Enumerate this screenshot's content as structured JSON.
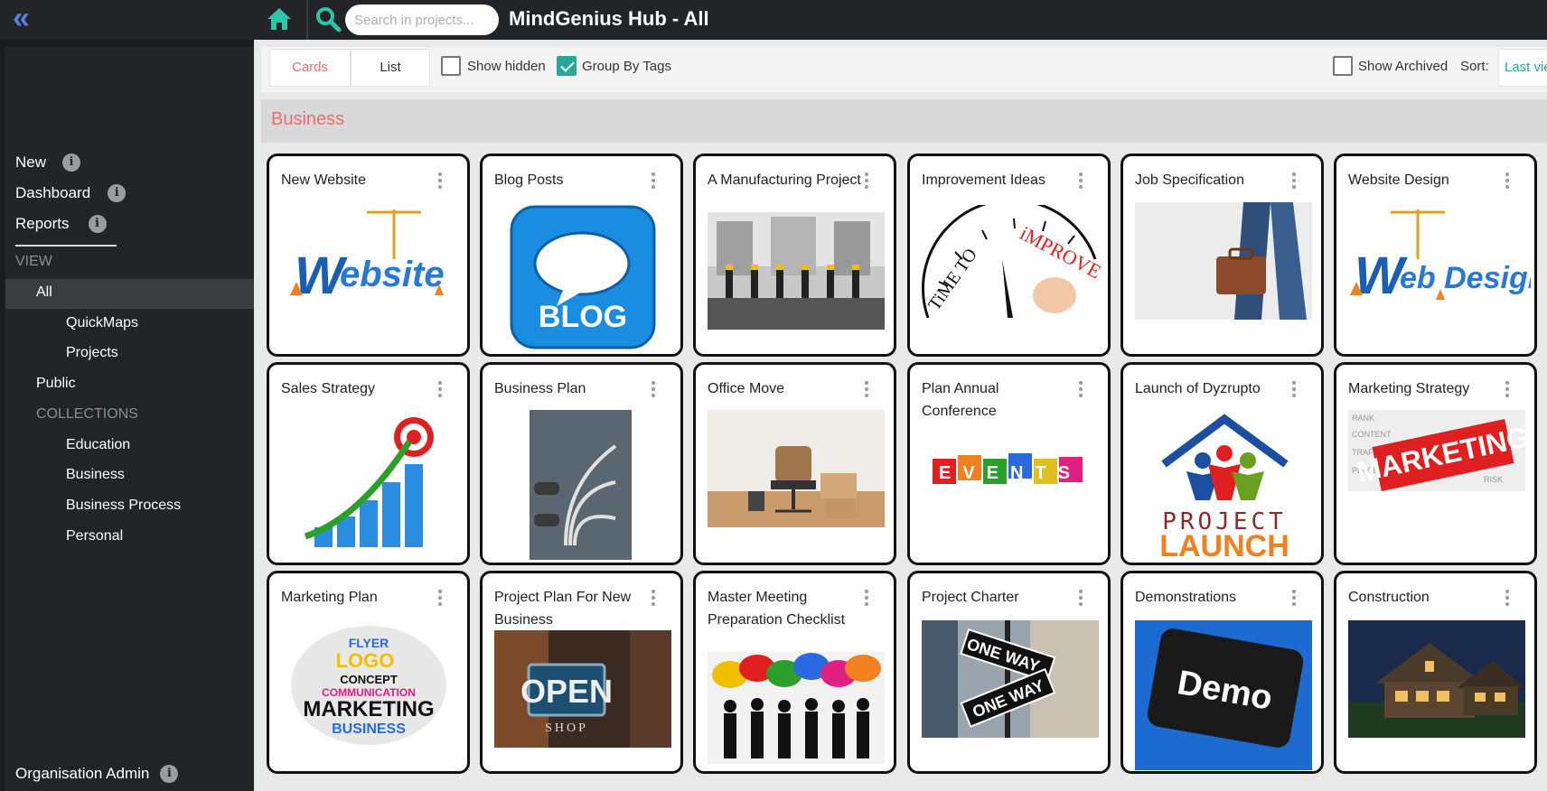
{
  "topbar": {
    "title": "MindGenius Hub - All",
    "search_placeholder": "Search in projects...",
    "icons": [
      "chevron-double-left-icon",
      "home-icon",
      "search-icon"
    ],
    "accent": "#2ec4a7"
  },
  "sidebar": {
    "nav": [
      {
        "label": "New"
      },
      {
        "label": "Dashboard"
      },
      {
        "label": "Reports"
      }
    ],
    "view_label": "VIEW",
    "view_items": [
      {
        "label": "All",
        "selected": true
      },
      {
        "label": "QuickMaps"
      },
      {
        "label": "Projects"
      },
      {
        "label": "Public"
      }
    ],
    "collections_label": "COLLECTIONS",
    "collections": [
      {
        "label": "Education"
      },
      {
        "label": "Business"
      },
      {
        "label": "Business Process"
      },
      {
        "label": "Personal"
      }
    ],
    "footer": {
      "label": "Organisation Admin"
    }
  },
  "toolbar": {
    "tabs": [
      {
        "label": "Cards",
        "active": true
      },
      {
        "label": "List"
      }
    ],
    "show_hidden": {
      "label": "Show hidden",
      "checked": false
    },
    "group_by_tags": {
      "label": "Group By Tags",
      "checked": true
    },
    "show_archived": {
      "label": "Show Archived",
      "checked": false
    },
    "sort_label": "Sort:",
    "sort_value": "Last vie"
  },
  "group": {
    "title": "Business"
  },
  "cards": [
    {
      "title": "New Website",
      "image": "website"
    },
    {
      "title": "Blog Posts",
      "image": "blog",
      "image_text": "BLOG"
    },
    {
      "title": "A Manufacturing Project",
      "image": "factory"
    },
    {
      "title": "Improvement Ideas",
      "image": "improve",
      "image_text": "TIME TO iMPROVE"
    },
    {
      "title": "Job Specification",
      "image": "briefcase"
    },
    {
      "title": "Website Design",
      "image": "website-design"
    },
    {
      "title": "Sales Strategy",
      "image": "growth-chart"
    },
    {
      "title": "Business Plan",
      "image": "arrows"
    },
    {
      "title": "Office Move",
      "image": "office-chair"
    },
    {
      "title": "Plan Annual Conference",
      "image": "events",
      "image_text": "EVENTS"
    },
    {
      "title": "Launch of Dyzrupto",
      "image": "project-launch",
      "image_text": "PROJECT LAUNCH"
    },
    {
      "title": "Marketing Strategy",
      "image": "marketing",
      "image_text": "MARKETING"
    },
    {
      "title": "Marketing Plan",
      "image": "word-sphere",
      "image_text": "MARKETING"
    },
    {
      "title": "Project Plan For New Business",
      "image": "open-sign",
      "image_text": "OPEN"
    },
    {
      "title": "Master Meeting Preparation Checklist",
      "image": "speech-bubbles"
    },
    {
      "title": "Project Charter",
      "image": "one-way",
      "image_text": "ONE WAY"
    },
    {
      "title": "Demonstrations",
      "image": "demo-key",
      "image_text": "Demo"
    },
    {
      "title": "Construction",
      "image": "house"
    }
  ],
  "colors": {
    "sidebar_bg": "#222428",
    "accent_teal": "#2aa796",
    "accent_red": "#e86f6f",
    "link_blue": "#5b7de4"
  }
}
